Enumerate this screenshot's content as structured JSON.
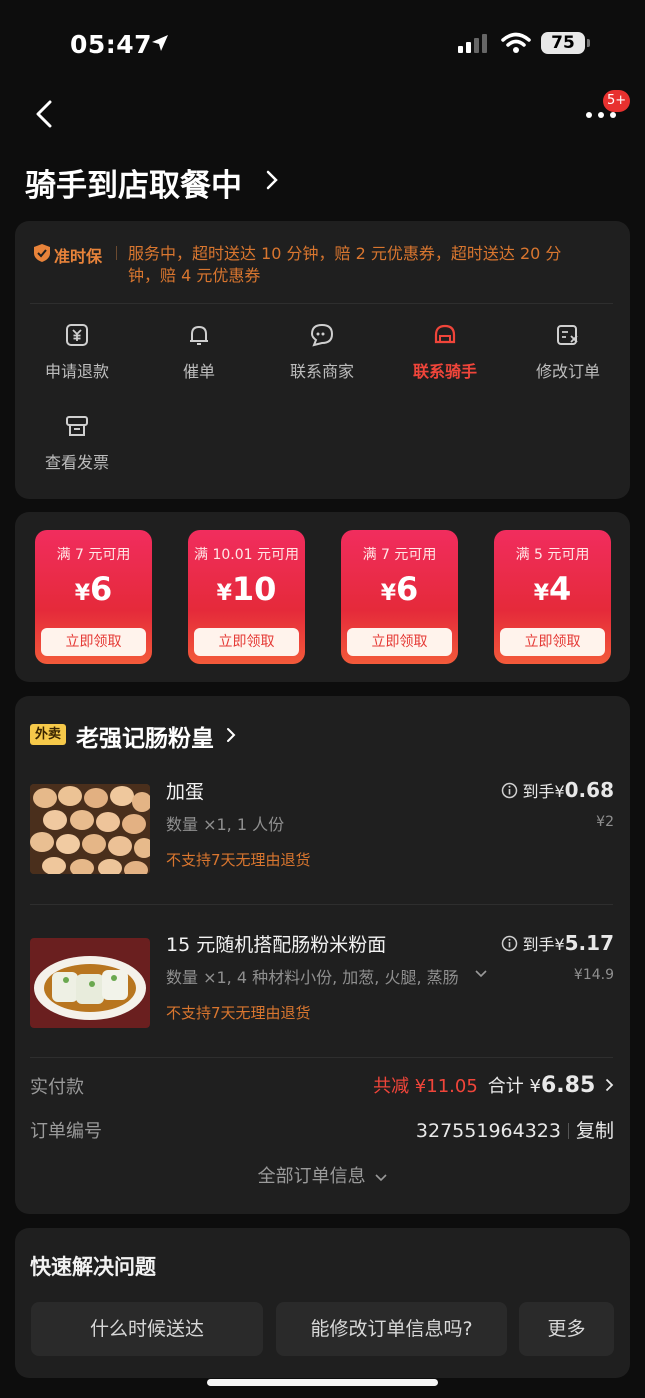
{
  "status_bar": {
    "time": "05:47",
    "battery": "75"
  },
  "nav": {
    "badge": "5+"
  },
  "header": {
    "title": "骑手到店取餐中"
  },
  "guarantee": {
    "name": "准时保",
    "text": "服务中，超时送达 10 分钟，赔 2 元优惠券，超时送达 20 分钟，赔 4 元优惠券"
  },
  "actions": [
    {
      "label": "申请退款",
      "icon": "refund-icon"
    },
    {
      "label": "催单",
      "icon": "bell-icon"
    },
    {
      "label": "联系商家",
      "icon": "chat-icon"
    },
    {
      "label": "联系骑手",
      "icon": "helmet-icon",
      "highlight": true
    },
    {
      "label": "修改订单",
      "icon": "edit-order-icon"
    },
    {
      "label": "查看发票",
      "icon": "invoice-icon"
    }
  ],
  "coupons": [
    {
      "condition": "满 7 元可用",
      "currency": "¥",
      "amount": "6",
      "button": "立即领取"
    },
    {
      "condition": "满 10.01 元可用",
      "currency": "¥",
      "amount": "10",
      "button": "立即领取"
    },
    {
      "condition": "满 7 元可用",
      "currency": "¥",
      "amount": "6",
      "button": "立即领取"
    },
    {
      "condition": "满 5 元可用",
      "currency": "¥",
      "amount": "4",
      "button": "立即领取"
    }
  ],
  "store": {
    "tag": "外卖",
    "name": "老强记肠粉皇"
  },
  "items": [
    {
      "name": "加蛋",
      "sub": "数量 ×1, 1 人份",
      "note": "不支持7天无理由退货",
      "net_prefix": "到手",
      "net_currency": "¥",
      "net_price": "0.68",
      "orig_price": "¥2"
    },
    {
      "name": "15 元随机搭配肠粉米粉面",
      "sub": "数量 ×1, 4 种材料小份, 加葱, 火腿, 蒸肠",
      "note": "不支持7天无理由退货",
      "net_prefix": "到手",
      "net_currency": "¥",
      "net_price": "5.17",
      "orig_price": "¥14.9"
    }
  ],
  "payment": {
    "label": "实付款",
    "discount": "共减 ¥11.05",
    "total_prefix": "合计 ¥",
    "total": "6.85"
  },
  "order": {
    "label": "订单编号",
    "number": "327551964323",
    "copy": "复制"
  },
  "all_info": "全部订单信息",
  "quick": {
    "title": "快速解决问题",
    "buttons": [
      "什么时候送达",
      "能修改订单信息吗?",
      "更多"
    ]
  },
  "colors": {
    "accent_red": "#f0453a",
    "orange": "#d9762f",
    "coupon_red": "#e52a3a",
    "tag_yellow": "#f6c94a"
  }
}
